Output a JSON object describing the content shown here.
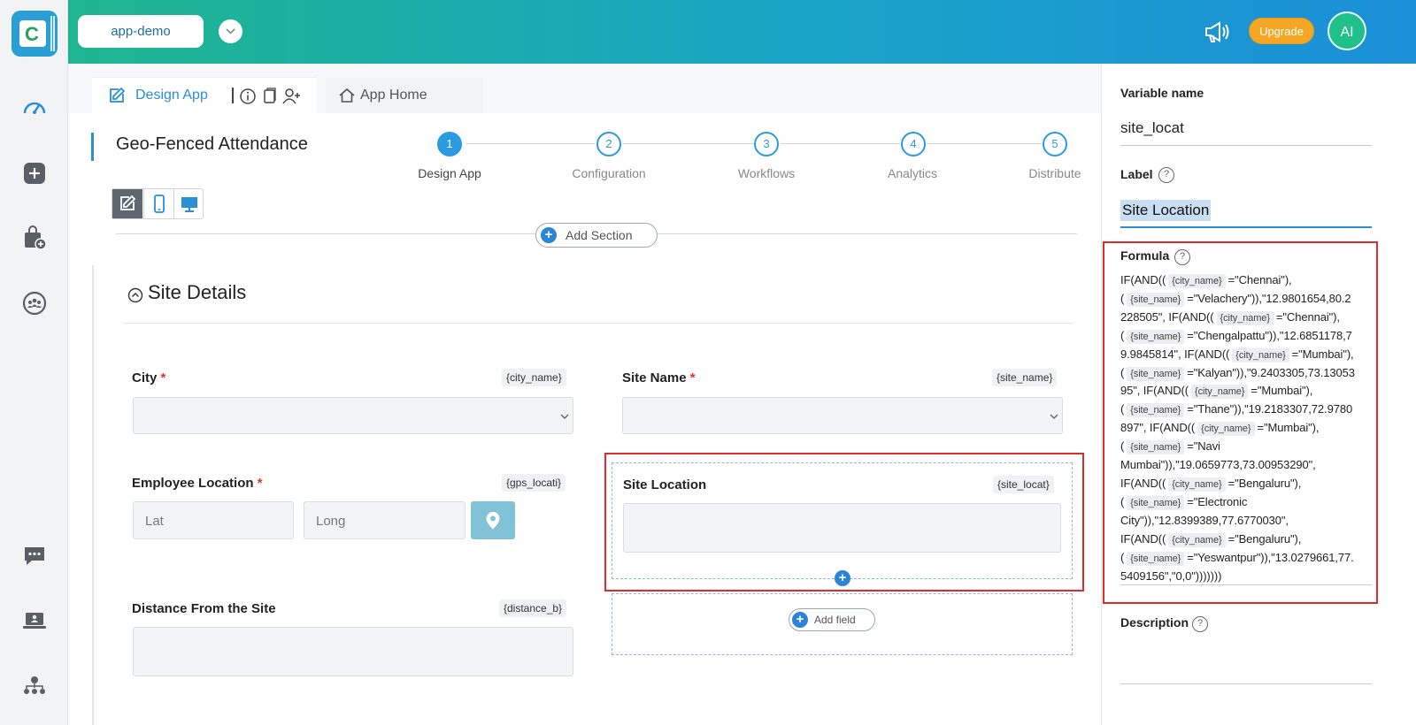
{
  "header": {
    "app_name": "app-demo",
    "upgrade_label": "Upgrade",
    "avatar_initials": "AI",
    "accent": "#1aa4c7",
    "brand_colors": {
      "upgrade": "#f5a623",
      "avatar": "#1fc08a"
    }
  },
  "rail": {
    "logo_letter": "C",
    "icons": [
      "speedometer-icon",
      "add-square-icon",
      "bag-add-icon",
      "team-icon",
      "chat-icon",
      "laptop-icon",
      "org-icon"
    ]
  },
  "tabs": {
    "design_label": "Design App",
    "home_label": "App Home"
  },
  "app": {
    "title": "Geo-Fenced Attendance"
  },
  "steps": [
    {
      "num": "1",
      "label": "Design App"
    },
    {
      "num": "2",
      "label": "Configuration"
    },
    {
      "num": "3",
      "label": "Workflows"
    },
    {
      "num": "4",
      "label": "Analytics"
    },
    {
      "num": "5",
      "label": "Distribute"
    }
  ],
  "canvas": {
    "add_section": "Add Section",
    "section_title": "Site Details",
    "add_field": "Add field",
    "fields": {
      "city": {
        "label": "City",
        "required": "*",
        "tag": "{city_name}"
      },
      "site_name": {
        "label": "Site Name",
        "required": "*",
        "tag": "{site_name}"
      },
      "employee_location": {
        "label": "Employee Location",
        "required": "*",
        "tag": "{gps_locati}",
        "lat_placeholder": "Lat",
        "long_placeholder": "Long"
      },
      "site_location": {
        "label": "Site Location",
        "tag": "{site_locat}"
      },
      "distance": {
        "label": "Distance From the Site",
        "tag": "{distance_b}"
      }
    }
  },
  "panel": {
    "variable_name_label": "Variable name",
    "variable_name_value": "site_locat",
    "label_label": "Label",
    "label_value": "Site Location",
    "formula_label": "Formula",
    "formula_lines": [
      [
        "IF(AND((",
        "{city_name}",
        "=\"Chennai\"),"
      ],
      [
        "(",
        "{site_name}",
        "=\"Velachery\")),\"12.9801654,80.2"
      ],
      [
        "228505\", IF(AND((",
        "{city_name}",
        "=\"Chennai\"),"
      ],
      [
        "(",
        "{site_name}",
        "=\"Chengalpattu\")),\"12.6851178,7"
      ],
      [
        "9.9845814\", IF(AND((",
        "{city_name}",
        "=\"Mumbai\"),"
      ],
      [
        "(",
        "{site_name}",
        "=\"Kalyan\")),\"9.2403305,73.13053"
      ],
      [
        "95\", IF(AND((",
        "{city_name}",
        "=\"Mumbai\"),"
      ],
      [
        "(",
        "{site_name}",
        "=\"Thane\")),\"19.2183307,72.9780"
      ],
      [
        "897\", IF(AND((",
        "{city_name}",
        "=\"Mumbai\"),"
      ],
      [
        "(",
        "{site_name}",
        "=\"Navi"
      ],
      [
        "Mumbai\")),\"19.0659773,73.00953290\",",
        "",
        ""
      ],
      [
        "IF(AND((",
        "{city_name}",
        "=\"Bengaluru\"),"
      ],
      [
        "(",
        "{site_name}",
        "=\"Electronic"
      ],
      [
        "City\")),\"12.8399389,77.6770030\",",
        "",
        ""
      ],
      [
        "IF(AND((",
        "{city_name}",
        "=\"Bengaluru\"),"
      ],
      [
        "(",
        "{site_name}",
        "=\"Yeswantpur\")),\"13.0279661,77."
      ],
      [
        "5409156\",\"0,0\")))))))",
        "",
        ""
      ]
    ],
    "description_label": "Description",
    "help_glyph": "?"
  }
}
